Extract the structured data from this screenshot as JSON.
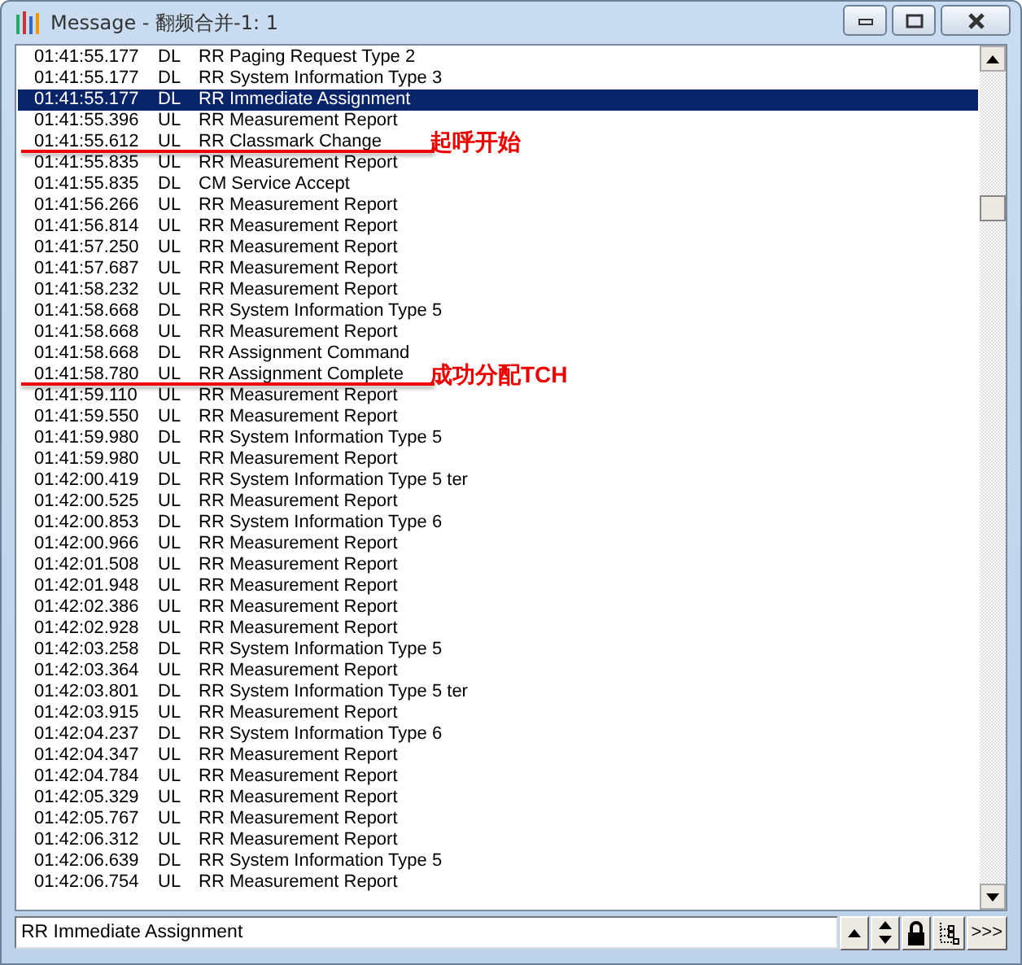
{
  "window": {
    "title": "Message - 翻频合并-1: 1"
  },
  "rows": [
    {
      "time": "01:41:55.177",
      "dir": "DL",
      "msg": "RR Paging Request Type 2",
      "selected": false
    },
    {
      "time": "01:41:55.177",
      "dir": "DL",
      "msg": "RR System Information Type 3",
      "selected": false
    },
    {
      "time": "01:41:55.177",
      "dir": "DL",
      "msg": "RR Immediate Assignment",
      "selected": true
    },
    {
      "time": "01:41:55.396",
      "dir": "UL",
      "msg": "RR Measurement Report",
      "selected": false
    },
    {
      "time": "01:41:55.612",
      "dir": "UL",
      "msg": "RR Classmark Change",
      "selected": false,
      "annotation": "起呼开始"
    },
    {
      "time": "01:41:55.835",
      "dir": "UL",
      "msg": "RR Measurement Report",
      "selected": false
    },
    {
      "time": "01:41:55.835",
      "dir": "DL",
      "msg": "CM Service Accept",
      "selected": false
    },
    {
      "time": "01:41:56.266",
      "dir": "UL",
      "msg": "RR Measurement Report",
      "selected": false
    },
    {
      "time": "01:41:56.814",
      "dir": "UL",
      "msg": "RR Measurement Report",
      "selected": false
    },
    {
      "time": "01:41:57.250",
      "dir": "UL",
      "msg": "RR Measurement Report",
      "selected": false
    },
    {
      "time": "01:41:57.687",
      "dir": "UL",
      "msg": "RR Measurement Report",
      "selected": false
    },
    {
      "time": "01:41:58.232",
      "dir": "UL",
      "msg": "RR Measurement Report",
      "selected": false
    },
    {
      "time": "01:41:58.668",
      "dir": "DL",
      "msg": "RR System Information Type 5",
      "selected": false
    },
    {
      "time": "01:41:58.668",
      "dir": "UL",
      "msg": "RR Measurement Report",
      "selected": false
    },
    {
      "time": "01:41:58.668",
      "dir": "DL",
      "msg": "RR Assignment Command",
      "selected": false
    },
    {
      "time": "01:41:58.780",
      "dir": "UL",
      "msg": "RR Assignment Complete",
      "selected": false,
      "annotation": "成功分配TCH"
    },
    {
      "time": "01:41:59.110",
      "dir": "UL",
      "msg": "RR Measurement Report",
      "selected": false
    },
    {
      "time": "01:41:59.550",
      "dir": "UL",
      "msg": "RR Measurement Report",
      "selected": false
    },
    {
      "time": "01:41:59.980",
      "dir": "DL",
      "msg": "RR System Information Type 5",
      "selected": false
    },
    {
      "time": "01:41:59.980",
      "dir": "UL",
      "msg": "RR Measurement Report",
      "selected": false
    },
    {
      "time": "01:42:00.419",
      "dir": "DL",
      "msg": "RR System Information Type 5 ter",
      "selected": false
    },
    {
      "time": "01:42:00.525",
      "dir": "UL",
      "msg": "RR Measurement Report",
      "selected": false
    },
    {
      "time": "01:42:00.853",
      "dir": "DL",
      "msg": "RR System Information Type 6",
      "selected": false
    },
    {
      "time": "01:42:00.966",
      "dir": "UL",
      "msg": "RR Measurement Report",
      "selected": false
    },
    {
      "time": "01:42:01.508",
      "dir": "UL",
      "msg": "RR Measurement Report",
      "selected": false
    },
    {
      "time": "01:42:01.948",
      "dir": "UL",
      "msg": "RR Measurement Report",
      "selected": false
    },
    {
      "time": "01:42:02.386",
      "dir": "UL",
      "msg": "RR Measurement Report",
      "selected": false
    },
    {
      "time": "01:42:02.928",
      "dir": "UL",
      "msg": "RR Measurement Report",
      "selected": false
    },
    {
      "time": "01:42:03.258",
      "dir": "DL",
      "msg": "RR System Information Type 5",
      "selected": false
    },
    {
      "time": "01:42:03.364",
      "dir": "UL",
      "msg": "RR Measurement Report",
      "selected": false
    },
    {
      "time": "01:42:03.801",
      "dir": "DL",
      "msg": "RR System Information Type 5 ter",
      "selected": false
    },
    {
      "time": "01:42:03.915",
      "dir": "UL",
      "msg": "RR Measurement Report",
      "selected": false
    },
    {
      "time": "01:42:04.237",
      "dir": "DL",
      "msg": "RR System Information Type 6",
      "selected": false
    },
    {
      "time": "01:42:04.347",
      "dir": "UL",
      "msg": "RR Measurement Report",
      "selected": false
    },
    {
      "time": "01:42:04.784",
      "dir": "UL",
      "msg": "RR Measurement Report",
      "selected": false
    },
    {
      "time": "01:42:05.329",
      "dir": "UL",
      "msg": "RR Measurement Report",
      "selected": false
    },
    {
      "time": "01:42:05.767",
      "dir": "UL",
      "msg": "RR Measurement Report",
      "selected": false
    },
    {
      "time": "01:42:06.312",
      "dir": "UL",
      "msg": "RR Measurement Report",
      "selected": false
    },
    {
      "time": "01:42:06.639",
      "dir": "DL",
      "msg": "RR System Information Type 5",
      "selected": false
    },
    {
      "time": "01:42:06.754",
      "dir": "UL",
      "msg": "RR Measurement Report",
      "selected": false
    }
  ],
  "detail_field": {
    "value": "RR Immediate Assignment"
  },
  "toolbar_buttons": [
    {
      "kind": "up"
    },
    {
      "kind": "updown"
    },
    {
      "kind": "lock"
    },
    {
      "kind": "tree"
    },
    {
      "kind": "more",
      "label": ">>>"
    }
  ]
}
